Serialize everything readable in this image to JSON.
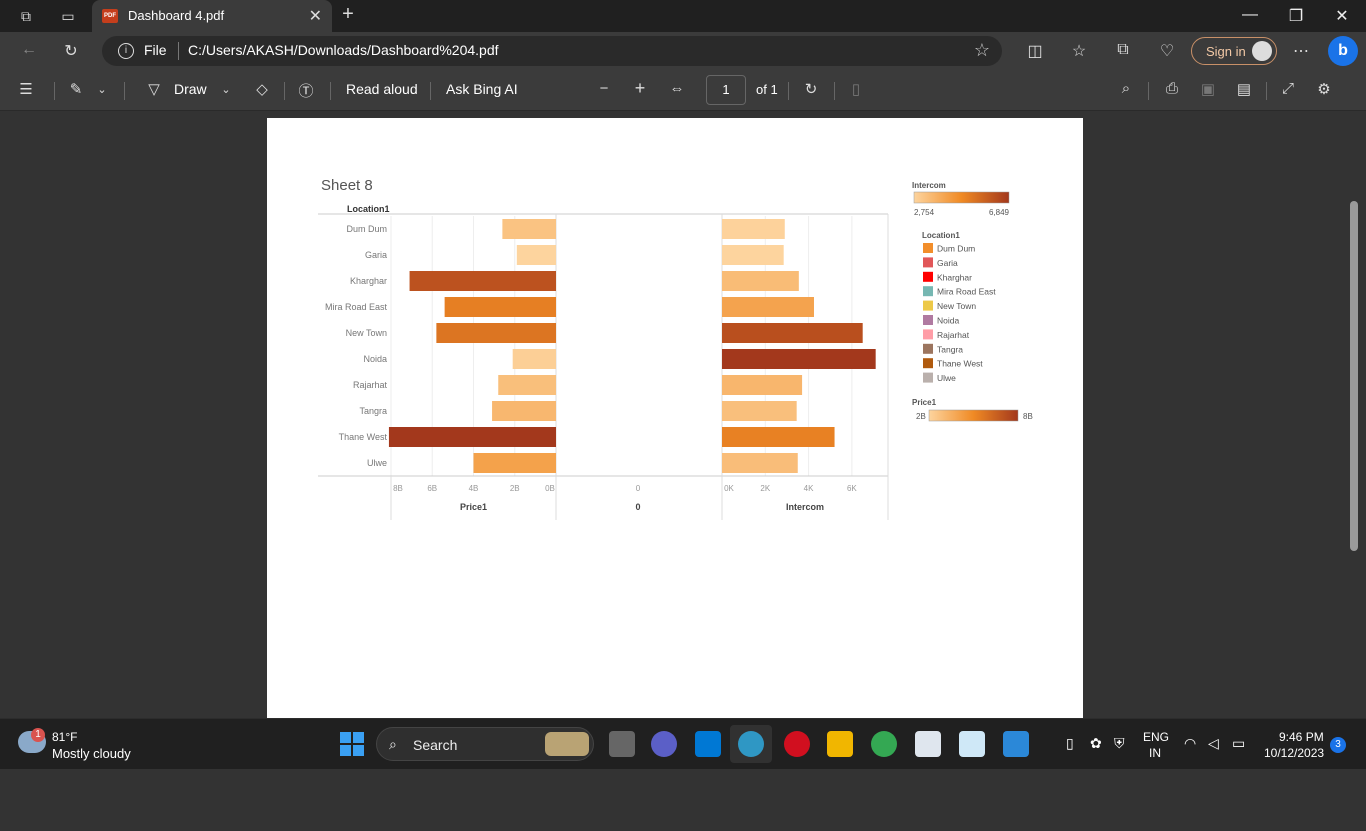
{
  "browser": {
    "tab_title": "Dashboard 4.pdf",
    "pdf_badge": "PDF",
    "address_file_label": "File",
    "address_url": "C:/Users/AKASH/Downloads/Dashboard%204.pdf",
    "signin_label": "Sign in"
  },
  "pdf_toolbar": {
    "draw_label": "Draw",
    "read_aloud_label": "Read aloud",
    "ask_ai_label": "Ask Bing AI",
    "page_number": "1",
    "page_of": "of 1"
  },
  "chart_data": {
    "type": "bar",
    "title": "Sheet 8",
    "row_header": "Location1",
    "categories": [
      "Dum Dum",
      "Garia",
      "Kharghar",
      "Mira Road East",
      "New Town",
      "Noida",
      "Rajarhat",
      "Tangra",
      "Thane West",
      "Ulwe"
    ],
    "series": [
      {
        "name": "Price1",
        "unit": "B",
        "values": [
          2.6,
          1.9,
          7.1,
          5.4,
          5.8,
          2.1,
          2.8,
          3.1,
          8.1,
          4.0
        ],
        "xlim": [
          8,
          0
        ],
        "ticks": [
          "8B",
          "6B",
          "4B",
          "2B",
          "0B"
        ],
        "xlabel": "Price1"
      },
      {
        "name": "0",
        "values": [],
        "ticks": [
          "0"
        ],
        "xlabel": "0"
      },
      {
        "name": "Intercom",
        "values": [
          2900,
          2850,
          3550,
          4250,
          6500,
          7100,
          3700,
          3450,
          5200,
          3500
        ],
        "xlim": [
          0,
          7300
        ],
        "ticks": [
          "0K",
          "2K",
          "4K",
          "6K"
        ],
        "xlabel": "Intercom"
      }
    ],
    "color_scale": {
      "low": "#fdd49e",
      "mid": "#f08a24",
      "high": "#a3381c"
    },
    "legend_intercom": {
      "title": "Intercom",
      "min": "2,754",
      "max": "6,849"
    },
    "legend_location": {
      "title": "Location1",
      "items": [
        {
          "label": "Dum Dum",
          "color": "#f28e2b"
        },
        {
          "label": "Garia",
          "color": "#e15759"
        },
        {
          "label": "Kharghar",
          "color": "#ff0000"
        },
        {
          "label": "Mira Road East",
          "color": "#76b7b2"
        },
        {
          "label": "New Town",
          "color": "#edc948"
        },
        {
          "label": "Noida",
          "color": "#b07aa1"
        },
        {
          "label": "Rajarhat",
          "color": "#ff9da7"
        },
        {
          "label": "Tangra",
          "color": "#9c755f"
        },
        {
          "label": "Thane West",
          "color": "#b05a0e"
        },
        {
          "label": "Ulwe",
          "color": "#bab0ac"
        }
      ]
    },
    "legend_price": {
      "title": "Price1",
      "min": "2B",
      "max": "8B"
    }
  },
  "taskbar": {
    "weather_temp": "81°F",
    "weather_desc": "Mostly cloudy",
    "weather_badge": "1",
    "search_label": "Search",
    "lang_top": "ENG",
    "lang_bottom": "IN",
    "time": "9:46 PM",
    "date": "10/12/2023",
    "notif_count": "3"
  }
}
